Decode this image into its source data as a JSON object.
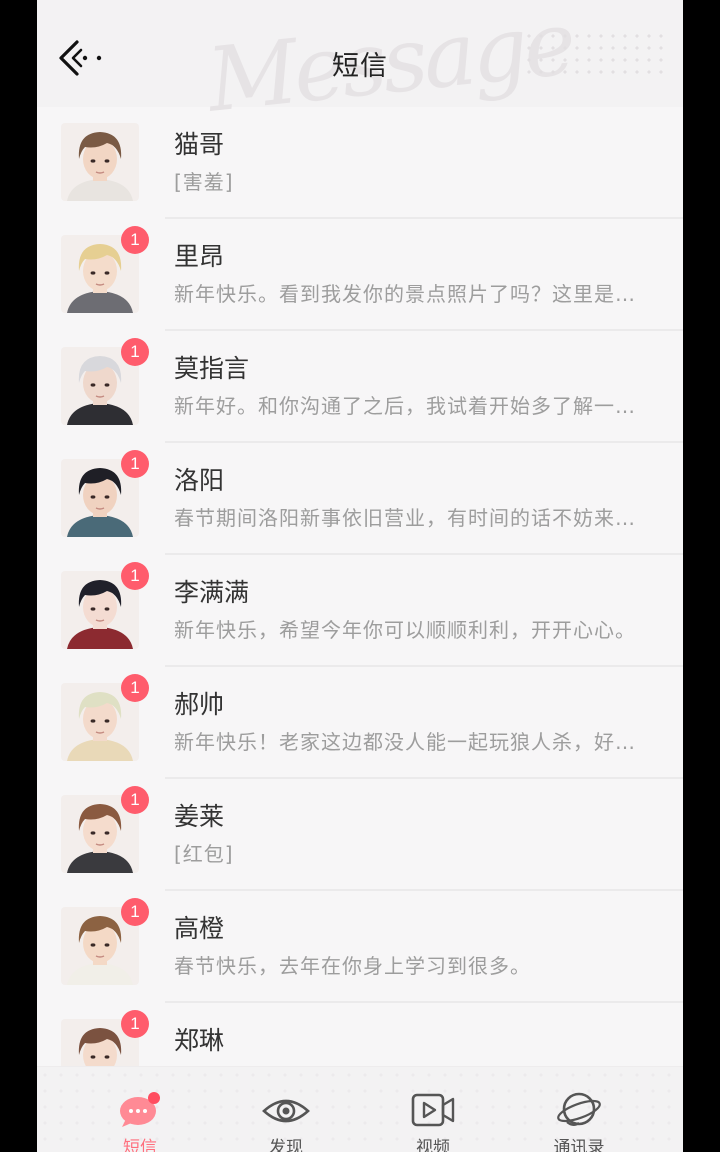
{
  "header": {
    "title": "短信",
    "bg_word": "Message"
  },
  "colors": {
    "accent": "#ff6f7d",
    "badge": "#ff5c6c"
  },
  "contacts": [
    {
      "name": "猫哥",
      "preview": "[害羞]",
      "badge": "",
      "hair": "#7a5a44",
      "skin": "#f2d6c4",
      "cloth": "#e8e4e0"
    },
    {
      "name": "里昂",
      "preview": "新年快乐。看到我发你的景点照片了吗？这里是不是很美？",
      "badge": "1",
      "hair": "#e6cf92",
      "skin": "#f4dccb",
      "cloth": "#6d6d73"
    },
    {
      "name": "莫指言",
      "preview": "新年好。和你沟通了之后，我试着开始多了解一些事情。",
      "badge": "1",
      "hair": "#d8d8dc",
      "skin": "#efd8cc",
      "cloth": "#2e2e33"
    },
    {
      "name": "洛阳",
      "preview": "春节期间洛阳新事依旧营业，有时间的话不妨来坐坐。",
      "badge": "1",
      "hair": "#1f1f26",
      "skin": "#f0d2c0",
      "cloth": "#4a6a78"
    },
    {
      "name": "李满满",
      "preview": "新年快乐，希望今年你可以顺顺利利，开开心心。",
      "badge": "1",
      "hair": "#20202a",
      "skin": "#f4dcd2",
      "cloth": "#8c2a30"
    },
    {
      "name": "郝帅",
      "preview": "新年快乐！老家这边都没人能一起玩狼人杀，好无聊。",
      "badge": "1",
      "hair": "#dfe0c4",
      "skin": "#f3dacb",
      "cloth": "#e9d9b8"
    },
    {
      "name": "姜莱",
      "preview": "[红包]",
      "badge": "1",
      "hair": "#8a5a40",
      "skin": "#f5dccd",
      "cloth": "#3a3a3e"
    },
    {
      "name": "高橙",
      "preview": "春节快乐，去年在你身上学习到很多。",
      "badge": "1",
      "hair": "#8c6242",
      "skin": "#f4d9c6",
      "cloth": "#f1efe8"
    },
    {
      "name": "郑琳",
      "preview": "",
      "badge": "1",
      "hair": "#7b5240",
      "skin": "#f4dbcc",
      "cloth": "#c9b7a5"
    }
  ],
  "tabs": [
    {
      "label": "短信",
      "icon": "message-icon"
    },
    {
      "label": "发现",
      "icon": "eye-icon"
    },
    {
      "label": "视频",
      "icon": "video-icon"
    },
    {
      "label": "通讯录",
      "icon": "contacts-icon"
    }
  ]
}
